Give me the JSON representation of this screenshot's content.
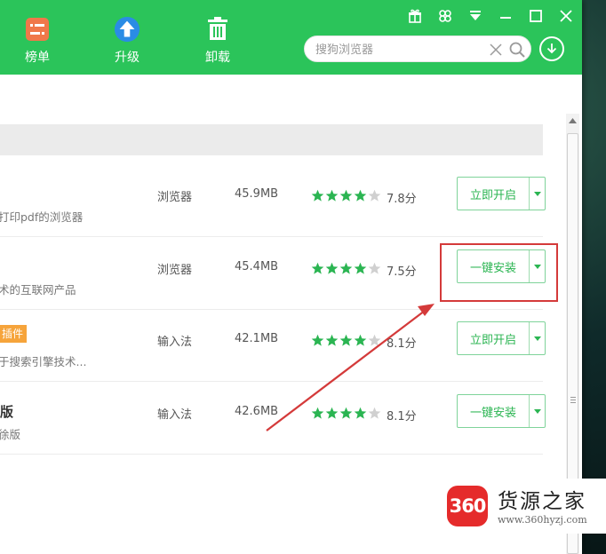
{
  "toolbar": {
    "rank_label": "榜单",
    "upgrade_label": "升级",
    "uninstall_label": "卸载"
  },
  "search": {
    "placeholder": "搜狗浏览器"
  },
  "colors": {
    "brand_green": "#2bc45a",
    "button_text_green": "#2bb552",
    "star_green": "#2bb552",
    "star_empty": "#d0d0d0",
    "tag_orange": "#f6a43b",
    "annotation_red": "#d43a3a"
  },
  "rows": [
    {
      "title": "",
      "tag": "",
      "description": "打印pdf的浏览器",
      "category": "浏览器",
      "size": "45.9MB",
      "rating_stars": 4,
      "score": "7.8分",
      "action": "立即开启"
    },
    {
      "title": "",
      "tag": "",
      "description": "术的互联网产品",
      "category": "浏览器",
      "size": "45.4MB",
      "rating_stars": 4,
      "score": "7.5分",
      "action": "一键安装"
    },
    {
      "title": "",
      "tag": "插件",
      "description": "于搜索引擎技术...",
      "category": "输入法",
      "size": "42.1MB",
      "rating_stars": 4,
      "score": "8.1分",
      "action": "立即开启"
    },
    {
      "title": "版",
      "tag": "",
      "description": "徐版",
      "category": "输入法",
      "size": "42.6MB",
      "rating_stars": 4,
      "score": "8.1分",
      "action": "一键安装"
    }
  ],
  "watermark": {
    "logo_text": "360",
    "title": "货源之家",
    "url": "www.360hyzj.com"
  }
}
